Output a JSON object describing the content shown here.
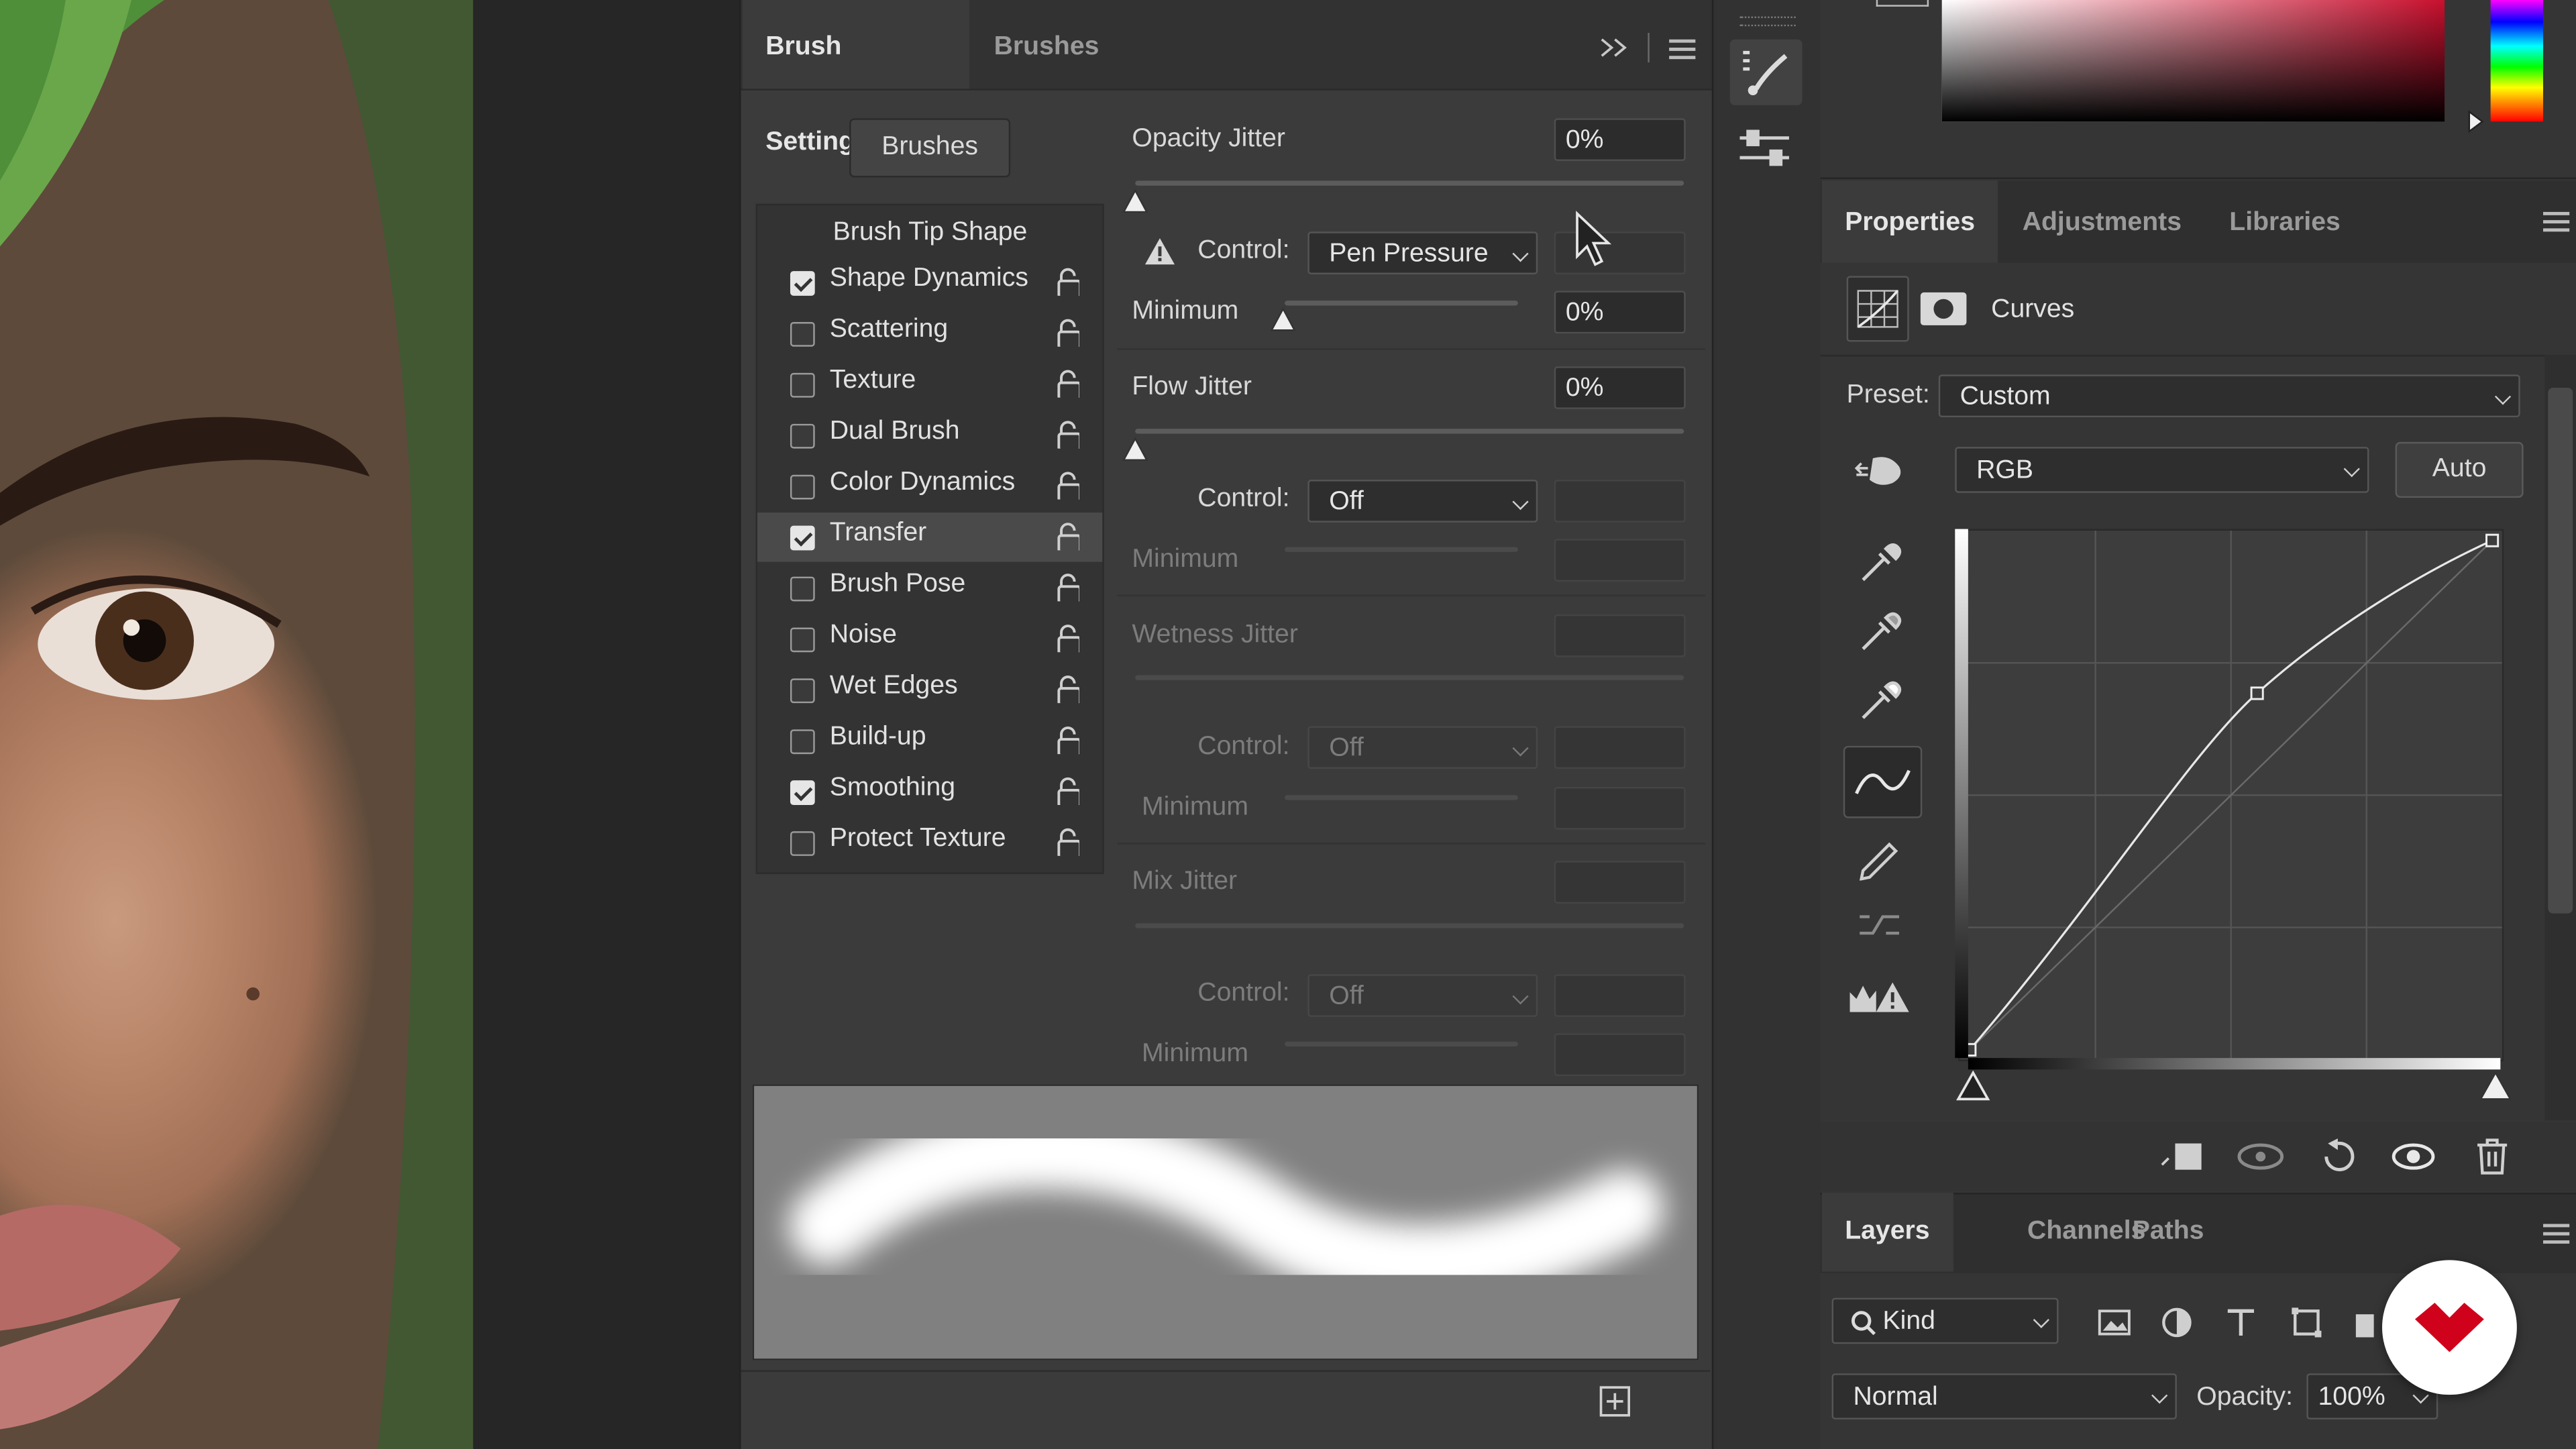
{
  "brush_settings": {
    "tabs": [
      {
        "label": "Brush Settings"
      },
      {
        "label": "Brushes"
      }
    ],
    "brushes_button": "Brushes",
    "tip_header": "Brush Tip Shape",
    "options": [
      {
        "label": "Shape Dynamics",
        "checked": true
      },
      {
        "label": "Scattering",
        "checked": false
      },
      {
        "label": "Texture",
        "checked": false
      },
      {
        "label": "Dual Brush",
        "checked": false
      },
      {
        "label": "Color Dynamics",
        "checked": false
      },
      {
        "label": "Transfer",
        "checked": true
      },
      {
        "label": "Brush Pose",
        "checked": false
      },
      {
        "label": "Noise",
        "checked": false
      },
      {
        "label": "Wet Edges",
        "checked": false
      },
      {
        "label": "Build-up",
        "checked": false
      },
      {
        "label": "Smoothing",
        "checked": true
      },
      {
        "label": "Protect Texture",
        "checked": false
      }
    ],
    "opacity_jitter": {
      "label": "Opacity Jitter",
      "value": "0%",
      "control_label": "Control:",
      "control_value": "Pen Pressure",
      "minimum_label": "Minimum",
      "minimum_value": "0%"
    },
    "flow_jitter": {
      "label": "Flow Jitter",
      "value": "0%",
      "control_label": "Control:",
      "control_value": "Off",
      "minimum_label": "Minimum"
    },
    "wetness_jitter": {
      "label": "Wetness Jitter",
      "control_label": "Control:",
      "control_value": "Off",
      "minimum_label": "Minimum"
    },
    "mix_jitter": {
      "label": "Mix Jitter",
      "control_label": "Control:",
      "control_value": "Off",
      "minimum_label": "Minimum"
    }
  },
  "properties": {
    "tabs": [
      {
        "label": "Properties"
      },
      {
        "label": "Adjustments"
      },
      {
        "label": "Libraries"
      }
    ],
    "adjustment_name": "Curves",
    "preset_label": "Preset:",
    "preset_value": "Custom",
    "channel_value": "RGB",
    "auto_button": "Auto",
    "curve_points": [
      [
        0,
        0
      ],
      [
        0.55,
        0.7
      ],
      [
        1,
        1
      ]
    ]
  },
  "layers": {
    "tabs": [
      {
        "label": "Layers"
      },
      {
        "label": "Channels"
      },
      {
        "label": "Paths"
      }
    ],
    "filter_value": "Kind",
    "blend_mode": "Normal",
    "opacity_label": "Opacity:",
    "opacity_value": "100%"
  },
  "colors": {
    "accent": "#e0e0e0",
    "panel": "#3b3b3b",
    "badge_red": "#d0021b"
  }
}
